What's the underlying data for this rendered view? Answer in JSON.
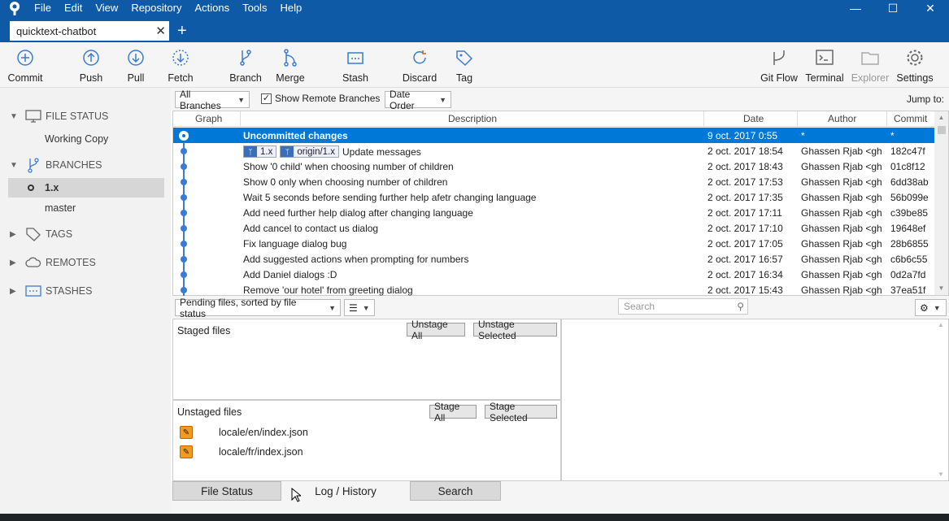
{
  "app": {
    "menus": [
      "File",
      "Edit",
      "View",
      "Repository",
      "Actions",
      "Tools",
      "Help"
    ],
    "tab_title": "quicktext-chatbot",
    "window_controls": [
      "minimize",
      "maximize",
      "close"
    ]
  },
  "toolbar": {
    "commit": "Commit",
    "push": "Push",
    "pull": "Pull",
    "fetch": "Fetch",
    "branch": "Branch",
    "merge": "Merge",
    "stash": "Stash",
    "discard": "Discard",
    "tag": "Tag",
    "gitflow": "Git Flow",
    "terminal": "Terminal",
    "explorer": "Explorer",
    "settings": "Settings"
  },
  "sidebar": {
    "file_status": "FILE STATUS",
    "working_copy": "Working Copy",
    "branches": "BRANCHES",
    "branch_items": [
      "1.x",
      "master"
    ],
    "tags": "TAGS",
    "remotes": "REMOTES",
    "stashes": "STASHES"
  },
  "filters": {
    "branches": "All Branches",
    "show_remote": "Show Remote Branches",
    "order": "Date Order",
    "jump_to": "Jump to:"
  },
  "columns": {
    "graph": "Graph",
    "description": "Description",
    "date": "Date",
    "author": "Author",
    "commit": "Commit"
  },
  "commits": [
    {
      "desc": "Uncommitted changes",
      "date": "9 oct. 2017 0:55",
      "author": "*",
      "hash": "*"
    },
    {
      "desc": "Update messages",
      "date": "2 oct. 2017 18:54",
      "author": "Ghassen Rjab <gha",
      "hash": "182c47f",
      "tags": [
        "1.x",
        "origin/1.x"
      ]
    },
    {
      "desc": "Show '0 child' when choosing number of children",
      "date": "2 oct. 2017 18:43",
      "author": "Ghassen Rjab <gha",
      "hash": "01c8f12"
    },
    {
      "desc": "Show 0 only when choosing number of children",
      "date": "2 oct. 2017 17:53",
      "author": "Ghassen Rjab <gha",
      "hash": "6dd38ab"
    },
    {
      "desc": "Wait 5 seconds before sending further help afetr changing language",
      "date": "2 oct. 2017 17:35",
      "author": "Ghassen Rjab <gha",
      "hash": "56b099e"
    },
    {
      "desc": "Add need further help dialog after changing language",
      "date": "2 oct. 2017 17:11",
      "author": "Ghassen Rjab <gha",
      "hash": "c39be85"
    },
    {
      "desc": "Add cancel to contact us dialog",
      "date": "2 oct. 2017 17:10",
      "author": "Ghassen Rjab <gha",
      "hash": "19648ef"
    },
    {
      "desc": "Fix language dialog bug",
      "date": "2 oct. 2017 17:05",
      "author": "Ghassen Rjab <gha",
      "hash": "28b6855"
    },
    {
      "desc": "Add suggested actions when prompting for numbers",
      "date": "2 oct. 2017 16:57",
      "author": "Ghassen Rjab <gha",
      "hash": "c6b6c55"
    },
    {
      "desc": "Add Daniel dialogs :D",
      "date": "2 oct. 2017 16:34",
      "author": "Ghassen Rjab <gha",
      "hash": "0d2a7fd"
    },
    {
      "desc": "Remove 'our hotel' from greeting dialog",
      "date": "2 oct. 2017 15:43",
      "author": "Ghassen Rjab <gha",
      "hash": "37ea51f"
    }
  ],
  "pending": {
    "sort": "Pending files, sorted by file status",
    "search_placeholder": "Search",
    "staged_title": "Staged files",
    "unstage_all": "Unstage All",
    "unstage_selected": "Unstage Selected",
    "unstaged_title": "Unstaged files",
    "stage_all": "Stage All",
    "stage_selected": "Stage Selected",
    "files": [
      "locale/en/index.json",
      "locale/fr/index.json"
    ]
  },
  "bottom_tabs": [
    "File Status",
    "Log / History",
    "Search"
  ],
  "colors": {
    "titlebar": "#0f5aa6",
    "selection": "#0078d7",
    "graph": "#3a7bd5",
    "modified_file": "#f29a1f"
  }
}
